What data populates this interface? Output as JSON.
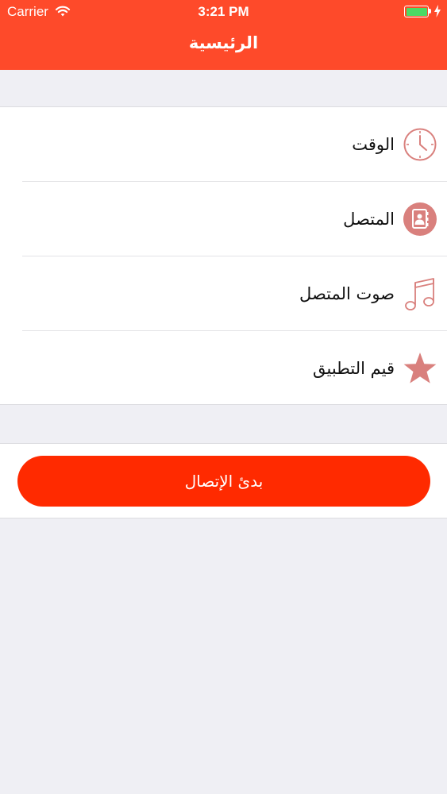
{
  "status_bar": {
    "carrier": "Carrier",
    "time": "3:21 PM"
  },
  "nav": {
    "title": "الرئيسية"
  },
  "menu": {
    "items": [
      {
        "label": "الوقت",
        "icon": "clock-icon"
      },
      {
        "label": "المتصل",
        "icon": "contact-book-icon"
      },
      {
        "label": "صوت المتصل",
        "icon": "music-note-icon"
      },
      {
        "label": "قيم التطبيق",
        "icon": "star-icon"
      }
    ]
  },
  "actions": {
    "start_call_label": "بدئ الإتصال"
  },
  "colors": {
    "header": "#fe4a2a",
    "button": "#ff2a00",
    "icon": "#d9807d",
    "battery": "#4cd964"
  }
}
